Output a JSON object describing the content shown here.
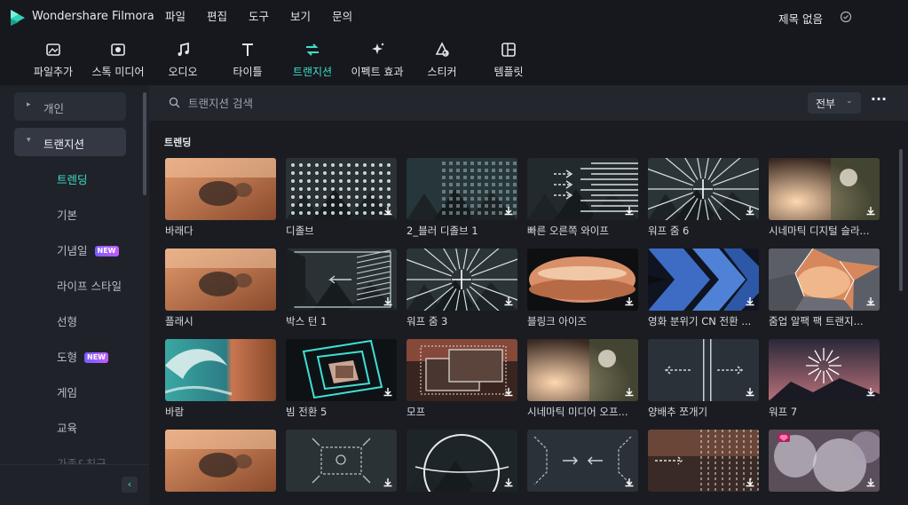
{
  "app": {
    "name": "Wondershare Filmora",
    "doc_title": "제목 없음"
  },
  "menu": [
    "파일",
    "편집",
    "도구",
    "보기",
    "문의"
  ],
  "toolbar": [
    {
      "label": "파일추가",
      "icon": "image-add-icon"
    },
    {
      "label": "스톡 미디어",
      "icon": "stock-media-icon"
    },
    {
      "label": "오디오",
      "icon": "music-note-icon"
    },
    {
      "label": "타이틀",
      "icon": "title-t-icon"
    },
    {
      "label": "트랜지션",
      "icon": "transition-arrows-icon",
      "active": true
    },
    {
      "label": "이펙트 효과",
      "icon": "effects-sparkle-icon"
    },
    {
      "label": "스티커",
      "icon": "sticker-icon"
    },
    {
      "label": "템플릿",
      "icon": "template-icon"
    }
  ],
  "sidebar": {
    "groups": [
      {
        "label": "개인",
        "arrow": "▸"
      },
      {
        "label": "트랜지션",
        "arrow": "▾"
      }
    ],
    "items": [
      {
        "label": "트렌딩",
        "selected": true
      },
      {
        "label": "기본"
      },
      {
        "label": "기념일",
        "badge": "NEW"
      },
      {
        "label": "라이프 스타일"
      },
      {
        "label": "선형"
      },
      {
        "label": "도형",
        "badge": "NEW"
      },
      {
        "label": "게임"
      },
      {
        "label": "교육"
      },
      {
        "label": "가족&친구"
      }
    ]
  },
  "search": {
    "placeholder": "트랜지션 검색"
  },
  "filter": {
    "value": "전부"
  },
  "section_title": "트렌딩",
  "cards": [
    {
      "label": "바래다",
      "art": "blur"
    },
    {
      "label": "디졸브",
      "art": "dots"
    },
    {
      "label": "2_블러 디졸브 1",
      "art": "bars"
    },
    {
      "label": "빠른 오른쪽 와이프",
      "art": "wipe"
    },
    {
      "label": "워프 줌 6",
      "art": "zoom"
    },
    {
      "label": "시네마틱 디지털 슬라...",
      "art": "cine"
    },
    {
      "label": "플래시",
      "art": "flash"
    },
    {
      "label": "박스 턴 1",
      "art": "box"
    },
    {
      "label": "워프 줌 3",
      "art": "zoom"
    },
    {
      "label": "블링크 아이즈",
      "art": "blink"
    },
    {
      "label": "영화 분위기 CN 전환 ...",
      "art": "chevrons"
    },
    {
      "label": "줌업 알팩 팩 트랜지...",
      "art": "aperture"
    },
    {
      "label": "바람",
      "art": "wave"
    },
    {
      "label": "빔 전환 5",
      "art": "beam"
    },
    {
      "label": "모프",
      "art": "morph"
    },
    {
      "label": "시네마틱 미디어 오프...",
      "art": "cine2"
    },
    {
      "label": "양배추 쪼개기",
      "art": "split"
    },
    {
      "label": "워프 7",
      "art": "burst"
    },
    {
      "label": "",
      "art": "blur"
    },
    {
      "label": "",
      "art": "frame"
    },
    {
      "label": "",
      "art": "circle"
    },
    {
      "label": "",
      "art": "arrows"
    },
    {
      "label": "",
      "art": "lines"
    },
    {
      "label": "",
      "art": "smoke"
    }
  ]
}
